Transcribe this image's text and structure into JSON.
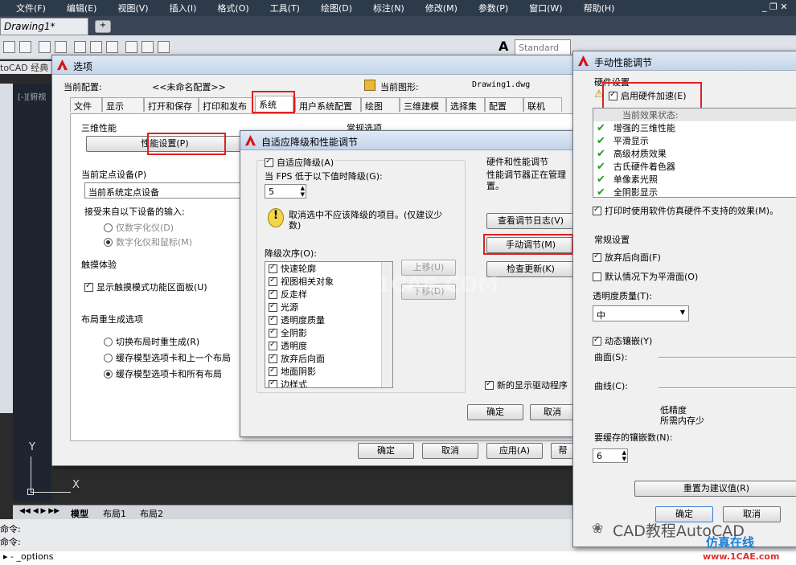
{
  "app": {
    "menus": [
      "文件(F)",
      "编辑(E)",
      "视图(V)",
      "插入(I)",
      "格式(O)",
      "工具(T)",
      "绘图(D)",
      "标注(N)",
      "修改(M)",
      "参数(P)",
      "窗口(W)",
      "帮助(H)"
    ],
    "doc_tab": "Drawing1*",
    "toolbar_style1": "Standard",
    "toolbar_style2": "Standard",
    "workspace_label": "toCAD 经典",
    "viewport_label": "[-][俯视",
    "model_tabs": [
      "模型",
      "布局1",
      "布局2"
    ],
    "cmd_lines": [
      "命令:",
      "命令:"
    ],
    "cmd_input": "_options"
  },
  "options": {
    "title": "选项",
    "profile_label": "当前配置:",
    "profile_value": "<<未命名配置>>",
    "drawing_label": "当前图形:",
    "drawing_value": "Drawing1.dwg",
    "tabs": [
      "文件",
      "显示",
      "打开和保存",
      "打印和发布",
      "系统",
      "用户系统配置",
      "绘图",
      "三维建模",
      "选择集",
      "配置",
      "联机"
    ],
    "g3d": "三维性能",
    "perf_btn": "性能设置(P)",
    "pointing_label": "当前定点设备(P)",
    "pointing_value": "当前系统定点设备",
    "accept_label": "接受来自以下设备的输入:",
    "opt_digitizer": "仅数字化仪(D)",
    "opt_both": "数字化仪和鼠标(M)",
    "touch_label": "触摸体验",
    "touch_chk": "显示触摸模式功能区面板(U)",
    "layout_label": "布局重生成选项",
    "r1": "切换布局时重生成(R)",
    "r2": "缓存模型选项卡和上一个布局",
    "r3": "缓存模型选项卡和所有布局",
    "general_label": "常规选项",
    "ok": "确定",
    "cancel": "取消",
    "apply": "应用(A)",
    "help": "帮"
  },
  "adaptive": {
    "title": "自适应降级和性能调节",
    "chk_adaptive": "自适应降级(A)",
    "fps_label": "当 FPS 低于以下值时降级(G):",
    "fps_value": "5",
    "hint": "取消选中不应该降级的项目。(仅建议少数)",
    "order_label": "降级次序(O):",
    "items": [
      "快速轮廓",
      "视图相关对象",
      "反走样",
      "光源",
      "透明度质量",
      "全阴影",
      "透明度",
      "放弃后向面",
      "地面阴影",
      "边样式"
    ],
    "up": "上移(U)",
    "down": "下移(D)",
    "hw_label": "硬件和性能调节",
    "hw_text": "性能调节器正在管理",
    "hw_text2": "置。",
    "log_btn": "查看调节日志(V)",
    "manual_btn": "手动调节(M)",
    "update_btn": "检查更新(K)",
    "new_driver": "新的显示驱动程序",
    "ok": "确定",
    "cancel": "取消"
  },
  "manual": {
    "title": "手动性能调节",
    "hw_label": "硬件设置",
    "hw_accel": "启用硬件加速(E)",
    "effects_header": "当前效果状态:",
    "effects": [
      "增强的三维性能",
      "平滑显示",
      "高级材质效果",
      "古氏硬件着色器",
      "单像素光照",
      "全阴影显示"
    ],
    "print_chk": "打印时使用软件仿真硬件不支持的效果(M)。",
    "general_label": "常规设置",
    "discard_back": "放弃后向面(F)",
    "smooth_default": "默认情况下为平滑面(O)",
    "transp_label": "透明度质量(T):",
    "transp_value": "中",
    "dyn_tess": "动态镶嵌(Y)",
    "surface_label": "曲面(S):",
    "curve_label": "曲线(C):",
    "low_fidelity": "低精度",
    "less_memory": "所需内存少",
    "cache_label": "要缓存的镶嵌数(N):",
    "cache_value": "6",
    "reset_btn": "重置为建议值(R)",
    "ok": "确定",
    "cancel": "取消"
  },
  "watermark": {
    "text1": "CAD教程AutoCAD",
    "text2": "仿真在线",
    "text3": "www.1CAE.com",
    "center": "1CAE.COM"
  }
}
